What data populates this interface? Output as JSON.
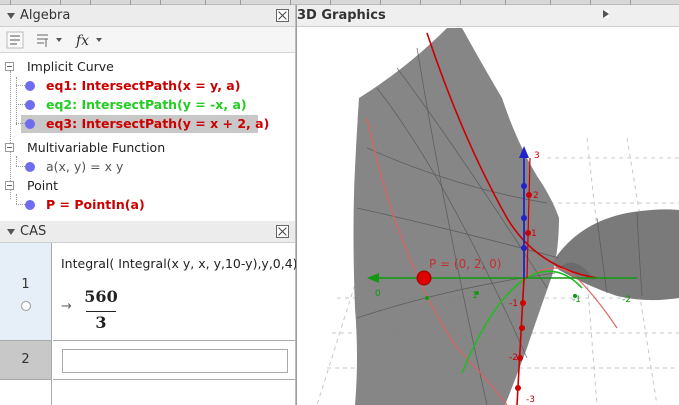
{
  "algebra": {
    "title": "Algebra",
    "categories": [
      {
        "label": "Implicit Curve",
        "items": [
          {
            "text": "eq1: IntersectPath(x = y, a)",
            "color": "#cc0000"
          },
          {
            "text": "eq2: IntersectPath(y = -x, a)",
            "color": "#22cc22"
          },
          {
            "text": "eq3: IntersectPath(y = x + 2, a)",
            "color": "#cc0000",
            "selected": true
          }
        ]
      },
      {
        "label": "Multivariable Function",
        "items": [
          {
            "text": "a(x, y) = x y",
            "color": "#555555"
          }
        ]
      },
      {
        "label": "Point",
        "items": [
          {
            "text": "P = PointIn(a)",
            "color": "#cc0000"
          }
        ]
      }
    ]
  },
  "cas": {
    "title": "CAS",
    "rows": [
      {
        "num": "1",
        "input": "Integral( Integral(x y, x, y,10-y),y,0,4)",
        "arrow": "→",
        "numerator": "560",
        "denominator": "3"
      },
      {
        "num": "2",
        "input": ""
      }
    ]
  },
  "graphics": {
    "title": "3D Graphics",
    "point_label": "P = (0, 2, 0)",
    "x_ticks": [
      "0",
      "1",
      "-1",
      "-2"
    ],
    "z_ticks": [
      "3",
      "2",
      "1",
      "-1",
      "-2",
      "-3"
    ],
    "surface_color": "#808080"
  }
}
